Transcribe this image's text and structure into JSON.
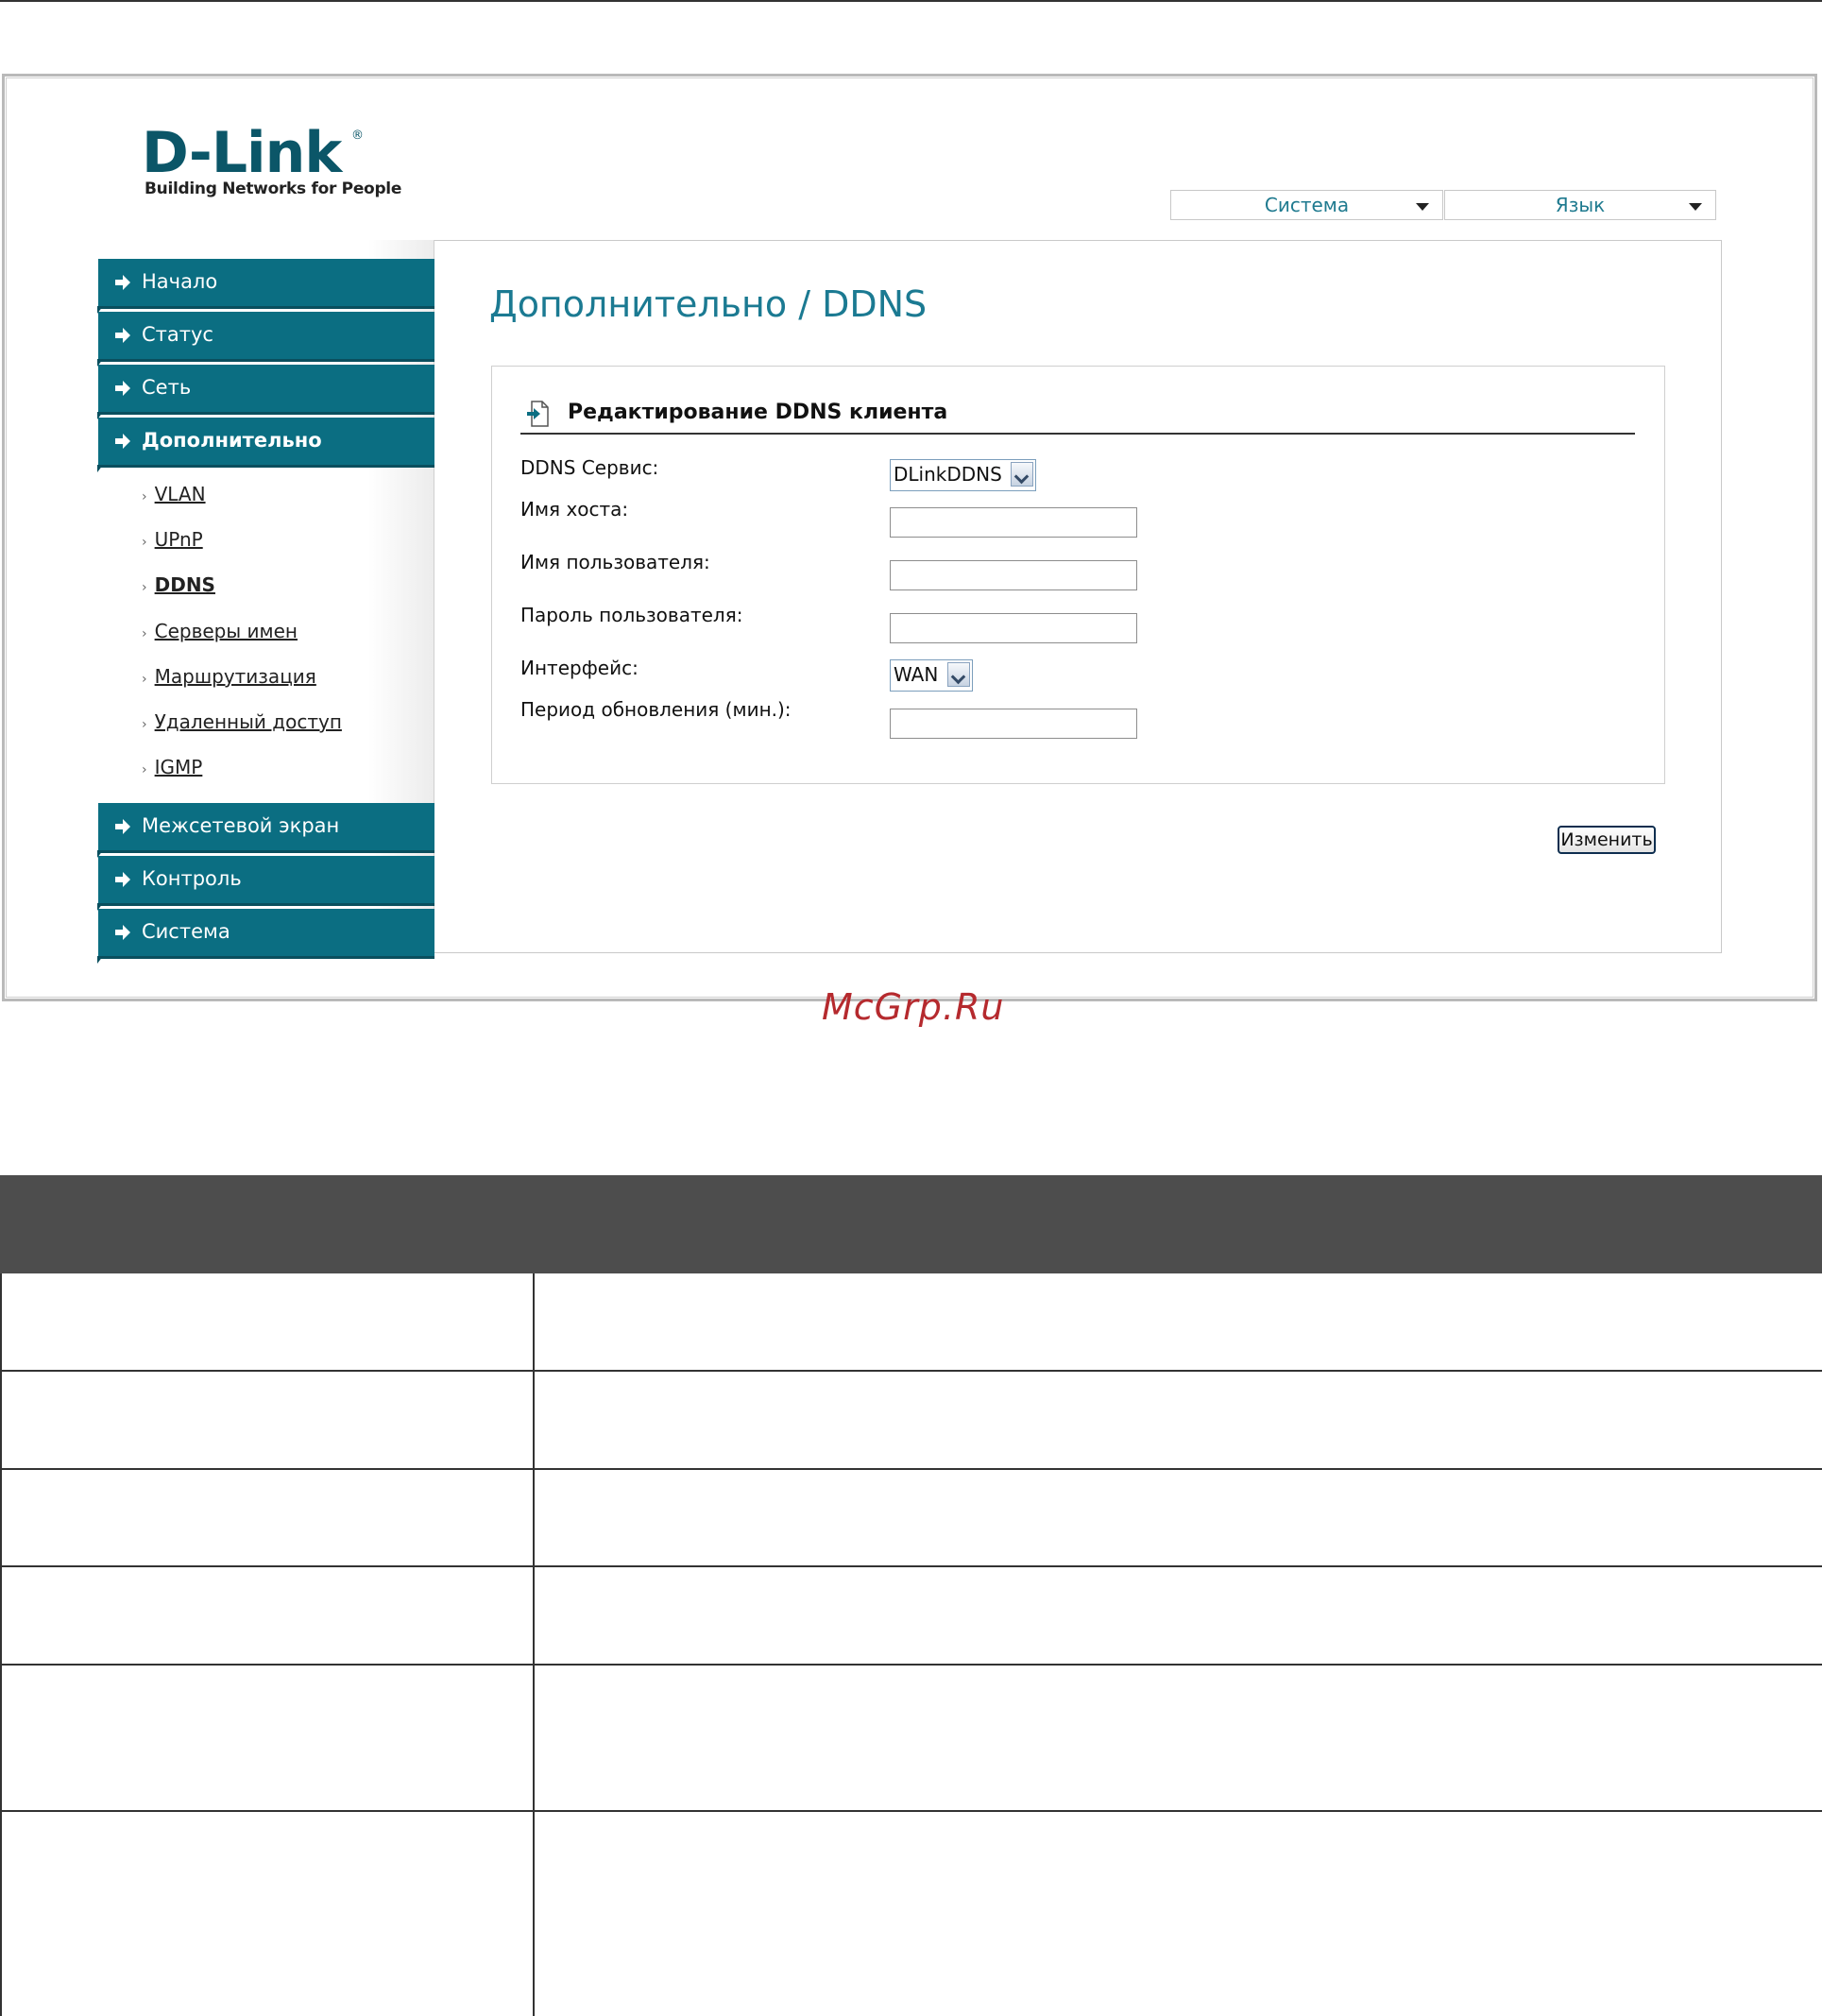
{
  "logo": {
    "brand": "D-Link",
    "registered": "®",
    "tagline": "Building Networks for People"
  },
  "top_menu": {
    "system": "Система",
    "language": "Язык"
  },
  "sidebar": {
    "main_items": [
      {
        "label": "Начало"
      },
      {
        "label": "Статус"
      },
      {
        "label": "Сеть"
      },
      {
        "label": "Дополнительно"
      }
    ],
    "sub_items": [
      {
        "label": "VLAN"
      },
      {
        "label": "UPnP"
      },
      {
        "label": "DDNS"
      },
      {
        "label": "Серверы имен"
      },
      {
        "label": "Маршрутизация"
      },
      {
        "label": "Удаленный доступ"
      },
      {
        "label": "IGMP"
      }
    ],
    "bottom_items": [
      {
        "label": "Межсетевой экран"
      },
      {
        "label": "Контроль"
      },
      {
        "label": "Система"
      }
    ]
  },
  "page_title": "Дополнительно /  DDNS",
  "form": {
    "heading": "Редактирование DDNS клиента",
    "fields": {
      "ddns_service_label": "DDNS Сервис:",
      "ddns_service_value": "DLinkDDNS",
      "hostname_label": "Имя хоста:",
      "hostname_value": "",
      "username_label": "Имя пользователя:",
      "username_value": "",
      "password_label": "Пароль пользователя:",
      "password_value": "",
      "interface_label": "Интерфейс:",
      "interface_value": "WAN",
      "period_label": "Период обновления (мин.):",
      "period_value": ""
    },
    "change_button": "Изменить"
  },
  "watermark": "McGrp.Ru",
  "colors": {
    "nav_teal": "#0b6e82",
    "title_teal": "#1b7a92",
    "table_header": "#4d4d4d",
    "watermark": "#b52a2e"
  }
}
